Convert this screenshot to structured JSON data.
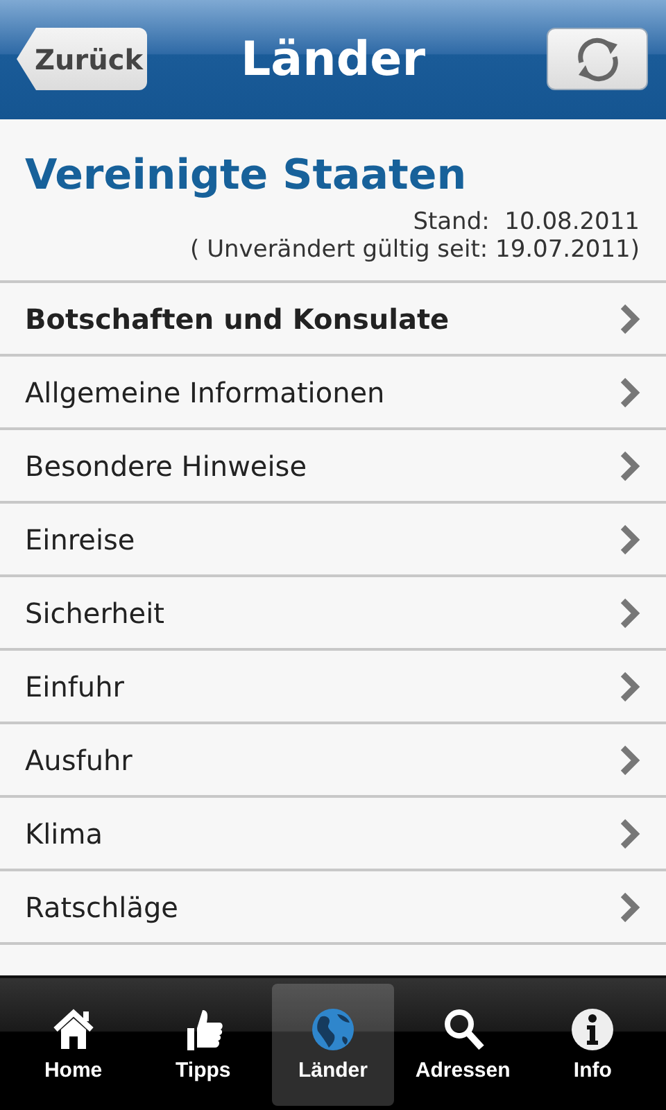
{
  "header": {
    "back": "Zurück",
    "title": "Länder"
  },
  "country": {
    "name": "Vereinigte Staaten",
    "stand": "Stand:  10.08.2011",
    "valid": "( Unverändert gültig seit: 19.07.2011)"
  },
  "items": [
    {
      "label": "Botschaften und Konsulate",
      "bold": true
    },
    {
      "label": "Allgemeine Informationen",
      "bold": false
    },
    {
      "label": "Besondere Hinweise",
      "bold": false
    },
    {
      "label": "Einreise",
      "bold": false
    },
    {
      "label": "Sicherheit",
      "bold": false
    },
    {
      "label": "Einfuhr",
      "bold": false
    },
    {
      "label": "Ausfuhr",
      "bold": false
    },
    {
      "label": "Klima",
      "bold": false
    },
    {
      "label": "Ratschläge",
      "bold": false
    }
  ],
  "tabs": [
    {
      "label": "Home",
      "kind": "home",
      "selected": false
    },
    {
      "label": "Tipps",
      "kind": "thumb",
      "selected": false
    },
    {
      "label": "Länder",
      "kind": "globe",
      "selected": true
    },
    {
      "label": "Adressen",
      "kind": "search",
      "selected": false
    },
    {
      "label": "Info",
      "kind": "info",
      "selected": false
    }
  ]
}
